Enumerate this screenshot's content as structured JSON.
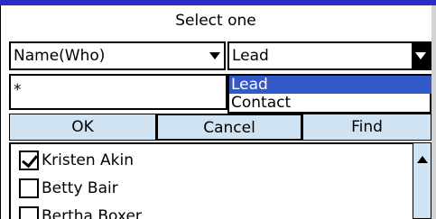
{
  "dialog": {
    "title": "Select one"
  },
  "field_select": {
    "value": "Name(Who)"
  },
  "type_select": {
    "value": "Lead",
    "options": [
      "Lead",
      "Contact"
    ],
    "selected_index": 0
  },
  "search": {
    "value": "*"
  },
  "buttons": {
    "ok": "OK",
    "cancel": "Cancel",
    "find": "Find"
  },
  "list": {
    "items": [
      {
        "name": "Kristen Akin",
        "checked": true
      },
      {
        "name": "Betty Bair",
        "checked": false
      },
      {
        "name": "Bertha Boxer",
        "checked": false
      }
    ]
  },
  "colors": {
    "title_bar": "#2c2cc4",
    "selection": "#3159c9",
    "button_bg": "#cfe3f2"
  }
}
